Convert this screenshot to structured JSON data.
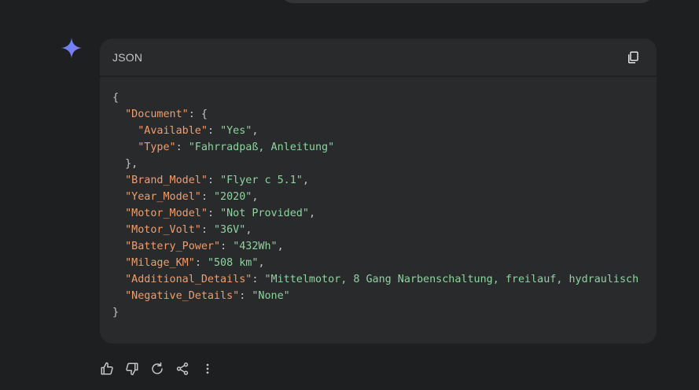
{
  "code_block": {
    "language_label": "JSON",
    "lines": [
      [
        {
          "c": "punc",
          "t": "{"
        }
      ],
      [
        {
          "c": "punc",
          "t": "  "
        },
        {
          "c": "key",
          "t": "\"Document\""
        },
        {
          "c": "punc",
          "t": ": {"
        }
      ],
      [
        {
          "c": "punc",
          "t": "    "
        },
        {
          "c": "key",
          "t": "\"Available\""
        },
        {
          "c": "punc",
          "t": ": "
        },
        {
          "c": "str",
          "t": "\"Yes\""
        },
        {
          "c": "punc",
          "t": ","
        }
      ],
      [
        {
          "c": "punc",
          "t": "    "
        },
        {
          "c": "key",
          "t": "\"Type\""
        },
        {
          "c": "punc",
          "t": ": "
        },
        {
          "c": "str",
          "t": "\"Fahrradpaß, Anleitung\""
        }
      ],
      [
        {
          "c": "punc",
          "t": "  },"
        }
      ],
      [
        {
          "c": "punc",
          "t": "  "
        },
        {
          "c": "key",
          "t": "\"Brand_Model\""
        },
        {
          "c": "punc",
          "t": ": "
        },
        {
          "c": "str",
          "t": "\"Flyer c 5.1\""
        },
        {
          "c": "punc",
          "t": ","
        }
      ],
      [
        {
          "c": "punc",
          "t": "  "
        },
        {
          "c": "key",
          "t": "\"Year_Model\""
        },
        {
          "c": "punc",
          "t": ": "
        },
        {
          "c": "str",
          "t": "\"2020\""
        },
        {
          "c": "punc",
          "t": ","
        }
      ],
      [
        {
          "c": "punc",
          "t": "  "
        },
        {
          "c": "key",
          "t": "\"Motor_Model\""
        },
        {
          "c": "punc",
          "t": ": "
        },
        {
          "c": "str",
          "t": "\"Not Provided\""
        },
        {
          "c": "punc",
          "t": ","
        }
      ],
      [
        {
          "c": "punc",
          "t": "  "
        },
        {
          "c": "key",
          "t": "\"Motor_Volt\""
        },
        {
          "c": "punc",
          "t": ": "
        },
        {
          "c": "str",
          "t": "\"36V\""
        },
        {
          "c": "punc",
          "t": ","
        }
      ],
      [
        {
          "c": "punc",
          "t": "  "
        },
        {
          "c": "key",
          "t": "\"Battery_Power\""
        },
        {
          "c": "punc",
          "t": ": "
        },
        {
          "c": "str",
          "t": "\"432Wh\""
        },
        {
          "c": "punc",
          "t": ","
        }
      ],
      [
        {
          "c": "punc",
          "t": "  "
        },
        {
          "c": "key",
          "t": "\"Milage_KM\""
        },
        {
          "c": "punc",
          "t": ": "
        },
        {
          "c": "str",
          "t": "\"508 km\""
        },
        {
          "c": "punc",
          "t": ","
        }
      ],
      [
        {
          "c": "punc",
          "t": "  "
        },
        {
          "c": "key",
          "t": "\"Additional_Details\""
        },
        {
          "c": "punc",
          "t": ": "
        },
        {
          "c": "str",
          "t": "\"Mittelmotor, 8 Gang Narbenschaltung, freilauf, hydraulisch"
        }
      ],
      [
        {
          "c": "punc",
          "t": "  "
        },
        {
          "c": "key",
          "t": "\"Negative_Details\""
        },
        {
          "c": "punc",
          "t": ": "
        },
        {
          "c": "str",
          "t": "\"None\""
        }
      ],
      [
        {
          "c": "punc",
          "t": "}"
        }
      ]
    ]
  },
  "icons": {
    "spark": "gemini-spark-icon",
    "copy": "copy-icon",
    "thumbs_up": "thumbs-up-icon",
    "thumbs_down": "thumbs-down-icon",
    "regenerate": "regenerate-icon",
    "share": "share-icon",
    "more": "more-vert-icon"
  },
  "colors": {
    "background": "#1e1f20",
    "card": "#282a2c",
    "key": "#f29d6b",
    "string": "#8fd3a0",
    "text": "#c4c7c5"
  }
}
